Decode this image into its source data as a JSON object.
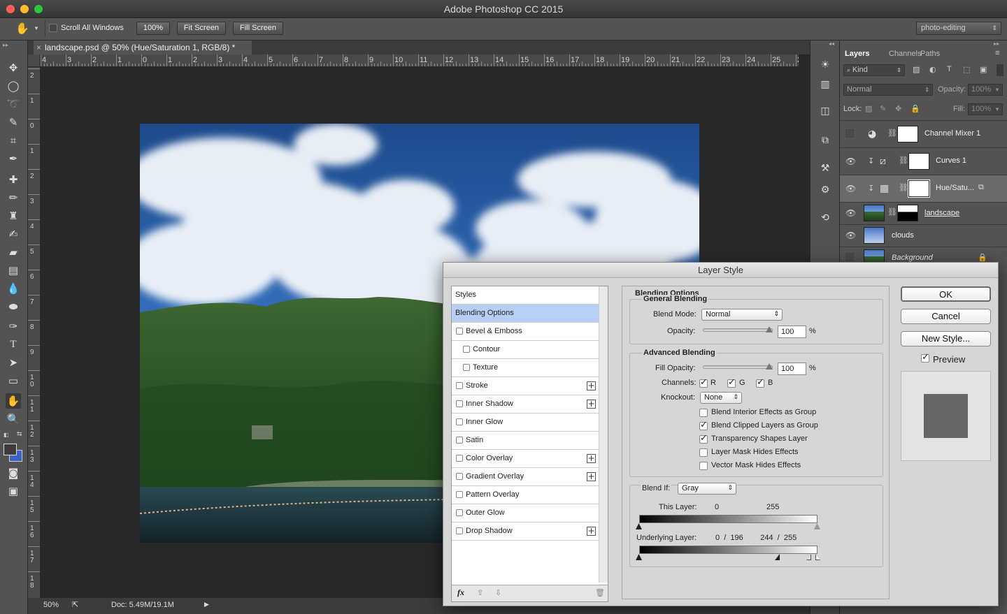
{
  "app": {
    "title": "Adobe Photoshop CC 2015"
  },
  "options_bar": {
    "scroll_all_label": "Scroll All Windows",
    "zoom_btn": "100%",
    "fit_screen": "Fit Screen",
    "fill_screen": "Fill Screen",
    "workspace": "photo-editing"
  },
  "document": {
    "tab_title": "landscape.psd @ 50% (Hue/Saturation 1, RGB/8) *",
    "close_glyph": "×"
  },
  "rulers": {
    "h_labels": [
      "4",
      "3",
      "2",
      "1",
      "0",
      "1",
      "2",
      "3",
      "4",
      "5",
      "6",
      "7",
      "8",
      "9",
      "10",
      "11",
      "12",
      "13",
      "14",
      "15",
      "16",
      "17",
      "18",
      "19",
      "20",
      "21",
      "22",
      "23",
      "24",
      "25",
      "26",
      "2"
    ],
    "v_labels": [
      "2",
      "1",
      "0",
      "1",
      "2",
      "3",
      "4",
      "5",
      "6",
      "7",
      "8",
      "9",
      "1 0",
      "1 1",
      "1 2",
      "1 3",
      "1 4",
      "1 5",
      "1 6",
      "1 7",
      "1 8"
    ]
  },
  "status": {
    "zoom": "50%",
    "doc": "Doc: 5.49M/19.1M"
  },
  "layers_panel": {
    "tabs": [
      "Layers",
      "Channels",
      "Paths"
    ],
    "kind_filter": "Kind",
    "blend_mode": "Normal",
    "opacity_label": "Opacity:",
    "opacity_value": "100%",
    "lock_label": "Lock:",
    "fill_label": "Fill:",
    "fill_value": "100%",
    "layers": [
      {
        "name": "Channel Mixer 1",
        "visible": false
      },
      {
        "name": "Curves 1",
        "visible": true
      },
      {
        "name": "Hue/Satu...",
        "visible": true
      },
      {
        "name": "landscape",
        "visible": true
      },
      {
        "name": "clouds",
        "visible": true
      },
      {
        "name": "Background",
        "visible": false
      }
    ]
  },
  "layer_style": {
    "title": "Layer Style",
    "styles_header": "Styles",
    "items": [
      {
        "label": "Blending Options",
        "checkbox": false,
        "checked": false,
        "plus": false,
        "indent": false,
        "selected": true
      },
      {
        "label": "Bevel & Emboss",
        "checkbox": true,
        "checked": false,
        "plus": false,
        "indent": false
      },
      {
        "label": "Contour",
        "checkbox": true,
        "checked": false,
        "plus": false,
        "indent": true
      },
      {
        "label": "Texture",
        "checkbox": true,
        "checked": false,
        "plus": false,
        "indent": true
      },
      {
        "label": "Stroke",
        "checkbox": true,
        "checked": false,
        "plus": true,
        "indent": false
      },
      {
        "label": "Inner Shadow",
        "checkbox": true,
        "checked": false,
        "plus": true,
        "indent": false
      },
      {
        "label": "Inner Glow",
        "checkbox": true,
        "checked": false,
        "plus": false,
        "indent": false
      },
      {
        "label": "Satin",
        "checkbox": true,
        "checked": false,
        "plus": false,
        "indent": false
      },
      {
        "label": "Color Overlay",
        "checkbox": true,
        "checked": false,
        "plus": true,
        "indent": false
      },
      {
        "label": "Gradient Overlay",
        "checkbox": true,
        "checked": false,
        "plus": true,
        "indent": false
      },
      {
        "label": "Pattern Overlay",
        "checkbox": true,
        "checked": false,
        "plus": false,
        "indent": false
      },
      {
        "label": "Outer Glow",
        "checkbox": true,
        "checked": false,
        "plus": false,
        "indent": false
      },
      {
        "label": "Drop Shadow",
        "checkbox": true,
        "checked": false,
        "plus": true,
        "indent": false
      }
    ],
    "footer_fx": "fx",
    "blending": {
      "header": "Blending Options",
      "general": "General Blending",
      "blend_mode_label": "Blend Mode:",
      "blend_mode_value": "Normal",
      "opacity_label": "Opacity:",
      "opacity_value": "100",
      "pct": "%",
      "advanced": "Advanced Blending",
      "fill_label": "Fill Opacity:",
      "fill_value": "100",
      "channels_label": "Channels:",
      "ch_r": "R",
      "ch_g": "G",
      "ch_b": "B",
      "knockout_label": "Knockout:",
      "knockout_value": "None",
      "options": [
        {
          "label": "Blend Interior Effects as Group",
          "checked": false
        },
        {
          "label": "Blend Clipped Layers as Group",
          "checked": true
        },
        {
          "label": "Transparency Shapes Layer",
          "checked": true
        },
        {
          "label": "Layer Mask Hides Effects",
          "checked": false
        },
        {
          "label": "Vector Mask Hides Effects",
          "checked": false
        }
      ],
      "blend_if_label": "Blend If:",
      "blend_if_value": "Gray",
      "this_layer_label": "This Layer:",
      "this_low": "0",
      "this_high": "255",
      "underlying_label": "Underlying Layer:",
      "under_values": "0  /  196        244  /  255"
    },
    "buttons": {
      "ok": "OK",
      "cancel": "Cancel",
      "new_style": "New Style...",
      "preview": "Preview"
    }
  }
}
